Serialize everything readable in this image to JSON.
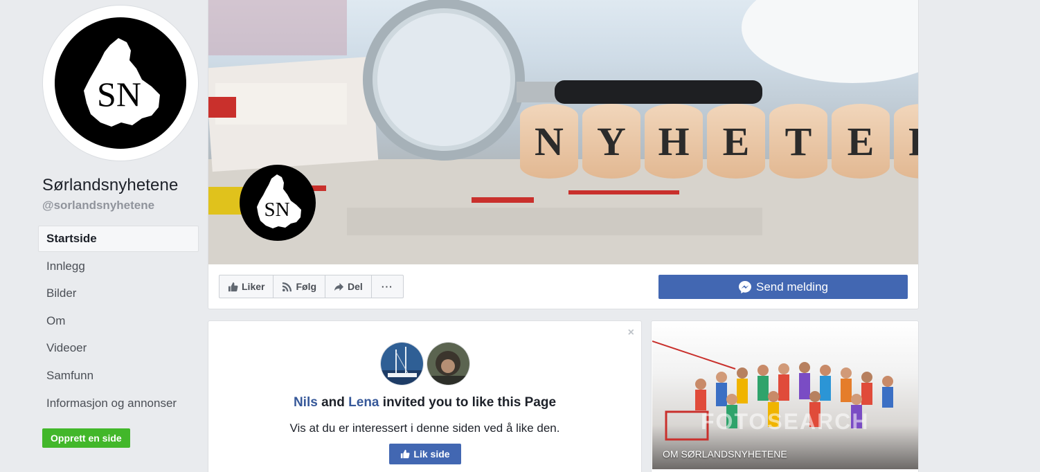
{
  "profile": {
    "name": "Sørlandsnyhetene",
    "handle": "@sorlandsnyhetene",
    "logo_text": "SN"
  },
  "nav": {
    "items": [
      {
        "label": "Startside",
        "active": true
      },
      {
        "label": "Innlegg"
      },
      {
        "label": "Bilder"
      },
      {
        "label": "Om"
      },
      {
        "label": "Videoer"
      },
      {
        "label": "Samfunn"
      },
      {
        "label": "Informasjon og annonser"
      }
    ],
    "create_page_label": "Opprett en side"
  },
  "cover": {
    "word_tiles": [
      "N",
      "Y",
      "H",
      "E",
      "T",
      "E",
      "R"
    ],
    "logo_text": "SN"
  },
  "actions": {
    "like_label": "Liker",
    "follow_label": "Følg",
    "share_label": "Del",
    "more_label": "···",
    "send_message_label": "Send melding"
  },
  "invite": {
    "inviter1": "Nils",
    "and_word": "and",
    "inviter2": "Lena",
    "rest": "invited you to like this Page",
    "subtitle": "Vis at du er interessert i denne siden ved å like den.",
    "like_page_label": "Lik side",
    "close_label": "×"
  },
  "about": {
    "label": "OM SØRLANDSNYHETENE",
    "watermark": "FOTOSEARCH"
  },
  "colors": {
    "background": "#e9ebee",
    "brand_blue": "#4267b2",
    "link_blue": "#365899",
    "create_green": "#42b72a"
  }
}
